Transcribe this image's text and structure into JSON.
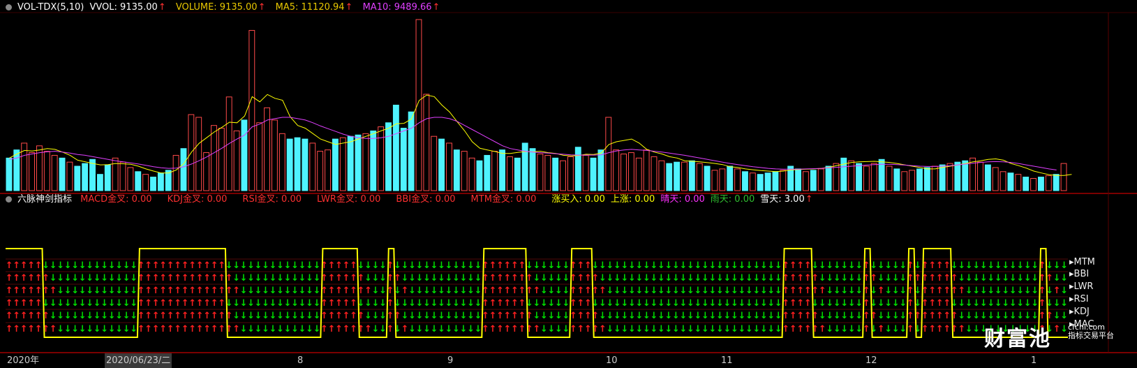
{
  "top_header": {
    "indicator": "VOL-TDX(5,10)",
    "vvol": "VVOL: 9135.00",
    "volume": "VOLUME: 9135.00",
    "ma5": "MA5: 11120.94",
    "ma10": "MA10: 9489.66",
    "arrow": "↑"
  },
  "bottom_header": {
    "title": "六脉神剑指标",
    "items": [
      {
        "label": "MACD金叉: 0.00",
        "color": "#ff3030"
      },
      {
        "label": "KDJ金叉: 0.00",
        "color": "#ff3030"
      },
      {
        "label": "RSI金叉: 0.00",
        "color": "#ff3030"
      },
      {
        "label": "LWR金叉: 0.00",
        "color": "#ff3030"
      },
      {
        "label": "BBI金叉: 0.00",
        "color": "#ff3030"
      },
      {
        "label": "MTM金叉: 0.00",
        "color": "#ff3030"
      },
      {
        "label": "涨买入: 0.00",
        "color": "#ffff00"
      },
      {
        "label": "上涨: 0.00",
        "color": "#ffff00"
      },
      {
        "label": "晴天: 0.00",
        "color": "#ff30ff"
      },
      {
        "label": "雨天: 0.00",
        "color": "#30c030"
      },
      {
        "label": "雪天: 3.00",
        "color": "#ffffff"
      }
    ],
    "arrow": "↑"
  },
  "signal_labels": [
    "MTM",
    "BBI",
    "LWR",
    "RSI",
    "KDJ",
    "MAC"
  ],
  "date_axis": {
    "labels": [
      "2020年",
      "2020/06/23/二",
      "8",
      "9",
      "10",
      "11",
      "12",
      "1"
    ]
  },
  "watermark": {
    "text": "财富池",
    "site": "cfchi.com",
    "tag": "指标交易平台"
  },
  "colors": {
    "up": "#ff4a4a",
    "down": "#4ff3ff",
    "ma5": "#ffff00",
    "ma10": "#e040ff",
    "green": "#00e000",
    "red": "#ff2020"
  },
  "chart_data": [
    {
      "type": "bar",
      "series": [
        {
          "name": "VOLUME",
          "values": [
            1200,
            1500,
            1750,
            1400,
            1650,
            1450,
            1300,
            1200,
            1050,
            900,
            1000,
            1150,
            600,
            950,
            1200,
            1050,
            850,
            700,
            600,
            500,
            650,
            750,
            1300,
            1550,
            2800,
            2700,
            1400,
            2400,
            2300,
            3450,
            2200,
            2600,
            5900,
            2500,
            3050,
            2600,
            2100,
            1900,
            1950,
            1900,
            1750,
            1450,
            1500,
            1900,
            1950,
            2000,
            2050,
            2100,
            2200,
            2350,
            2500,
            3150,
            2300,
            2900,
            6300,
            3550,
            2000,
            1900,
            1750,
            1500,
            1450,
            1200,
            1100,
            1300,
            1450,
            1500,
            1250,
            1200,
            1750,
            1550,
            1350,
            1300,
            1200,
            1100,
            1250,
            1600,
            1300,
            1200,
            1500,
            2700,
            1500,
            1350,
            1400,
            1200,
            1500,
            1250,
            1100,
            1000,
            1050,
            1050,
            1100,
            1000,
            900,
            750,
            800,
            900,
            800,
            700,
            650,
            600,
            650,
            700,
            750,
            900,
            800,
            700,
            750,
            800,
            900,
            1000,
            1200,
            1100,
            1000,
            900,
            1000,
            1150,
            900,
            800,
            700,
            750,
            800,
            850,
            900,
            950,
            1000,
            1050,
            1100,
            1200,
            1050,
            950,
            850,
            700,
            650,
            600,
            500,
            450,
            500,
            550,
            600,
            1000
          ]
        },
        {
          "name": "MA5",
          "values": [
            1200,
            1350,
            1480,
            1460,
            1500,
            1550,
            1520,
            1420,
            1300,
            1120,
            1060,
            1000,
            950,
            960,
            1000,
            990,
            970,
            900,
            800,
            720,
            650,
            650,
            760,
            1000,
            1420,
            1740,
            1950,
            2160,
            2330,
            2520,
            2500,
            2750,
            3460,
            3270,
            3540,
            3400,
            3330,
            2720,
            2400,
            2300,
            2100,
            1900,
            1800,
            1700,
            1750,
            1800,
            1900,
            2000,
            2100,
            2200,
            2300,
            2460,
            2480,
            2640,
            3320,
            3520,
            3460,
            3150,
            2900,
            2540,
            2200,
            1800,
            1560,
            1500,
            1440,
            1370,
            1370,
            1410,
            1440,
            1430,
            1450,
            1400,
            1370,
            1300,
            1280,
            1290,
            1340,
            1330,
            1380,
            1700,
            1800,
            1850,
            1900,
            1750,
            1520,
            1420,
            1350,
            1250,
            1200,
            1100,
            1080,
            1060,
            1030,
            1000,
            960,
            880,
            850,
            800,
            770,
            740,
            720,
            700,
            720,
            760,
            780,
            790,
            800,
            820,
            860,
            920,
            980,
            1040,
            1060,
            1070,
            1080,
            1060,
            1040,
            1000,
            950,
            900,
            850,
            800,
            800,
            860,
            900,
            950,
            1000,
            1060,
            1100,
            1150,
            1170,
            1120,
            1000,
            920,
            830,
            720,
            650,
            590,
            560,
            560,
            600
          ]
        },
        {
          "name": "MA10",
          "values": [
            1150,
            1200,
            1300,
            1350,
            1400,
            1430,
            1450,
            1420,
            1380,
            1330,
            1300,
            1250,
            1200,
            1150,
            1100,
            1060,
            1020,
            980,
            930,
            880,
            840,
            820,
            830,
            880,
            980,
            1100,
            1240,
            1400,
            1560,
            1740,
            1900,
            2050,
            2350,
            2450,
            2600,
            2650,
            2700,
            2700,
            2650,
            2600,
            2500,
            2380,
            2280,
            2180,
            2080,
            2000,
            1950,
            1920,
            1920,
            1950,
            2000,
            2100,
            2200,
            2300,
            2500,
            2650,
            2700,
            2700,
            2650,
            2550,
            2400,
            2250,
            2100,
            1950,
            1800,
            1650,
            1550,
            1500,
            1450,
            1420,
            1400,
            1380,
            1360,
            1340,
            1320,
            1310,
            1310,
            1310,
            1320,
            1400,
            1460,
            1500,
            1520,
            1500,
            1480,
            1450,
            1420,
            1380,
            1340,
            1300,
            1250,
            1200,
            1150,
            1100,
            1050,
            1000,
            960,
            920,
            880,
            850,
            820,
            800,
            790,
            790,
            790,
            800,
            810,
            820,
            840,
            860,
            880,
            900,
            920,
            940,
            960,
            970,
            970,
            960,
            940,
            920,
            900,
            890,
            890,
            900,
            920,
            950,
            980,
            1010,
            1040,
            1060,
            1070,
            1060,
            1040,
            1000,
            950,
            900,
            850,
            800,
            760
          ]
        }
      ]
    },
    {
      "type": "line",
      "series": [
        {
          "name": "上涨",
          "values": [
            1,
            1,
            1,
            1,
            1,
            0,
            0,
            0,
            0,
            0,
            0,
            0,
            0,
            0,
            0,
            0,
            0,
            0,
            1,
            1,
            1,
            1,
            1,
            1,
            1,
            1,
            1,
            1,
            1,
            1,
            0,
            0,
            0,
            0,
            0,
            0,
            0,
            0,
            0,
            0,
            0,
            0,
            0,
            1,
            1,
            1,
            1,
            1,
            0,
            0,
            0,
            0,
            1,
            0,
            0,
            0,
            0,
            0,
            0,
            0,
            0,
            0,
            0,
            0,
            0,
            1,
            1,
            1,
            1,
            1,
            1,
            0,
            0,
            0,
            0,
            0,
            0,
            1,
            1,
            1,
            0,
            0,
            0,
            0,
            0,
            0,
            0,
            0,
            0,
            0,
            0,
            0,
            0,
            0,
            0,
            0,
            0,
            0,
            0,
            0,
            0,
            0,
            0,
            0,
            0,
            0,
            1,
            1,
            1,
            1,
            0,
            0,
            0,
            0,
            0,
            0,
            0,
            1,
            0,
            0,
            0,
            0,
            0,
            1,
            0,
            1,
            1,
            1,
            1,
            0,
            0,
            0,
            0,
            0,
            0,
            0,
            0,
            0,
            0,
            0,
            0,
            1,
            0,
            0,
            0
          ]
        }
      ]
    }
  ]
}
